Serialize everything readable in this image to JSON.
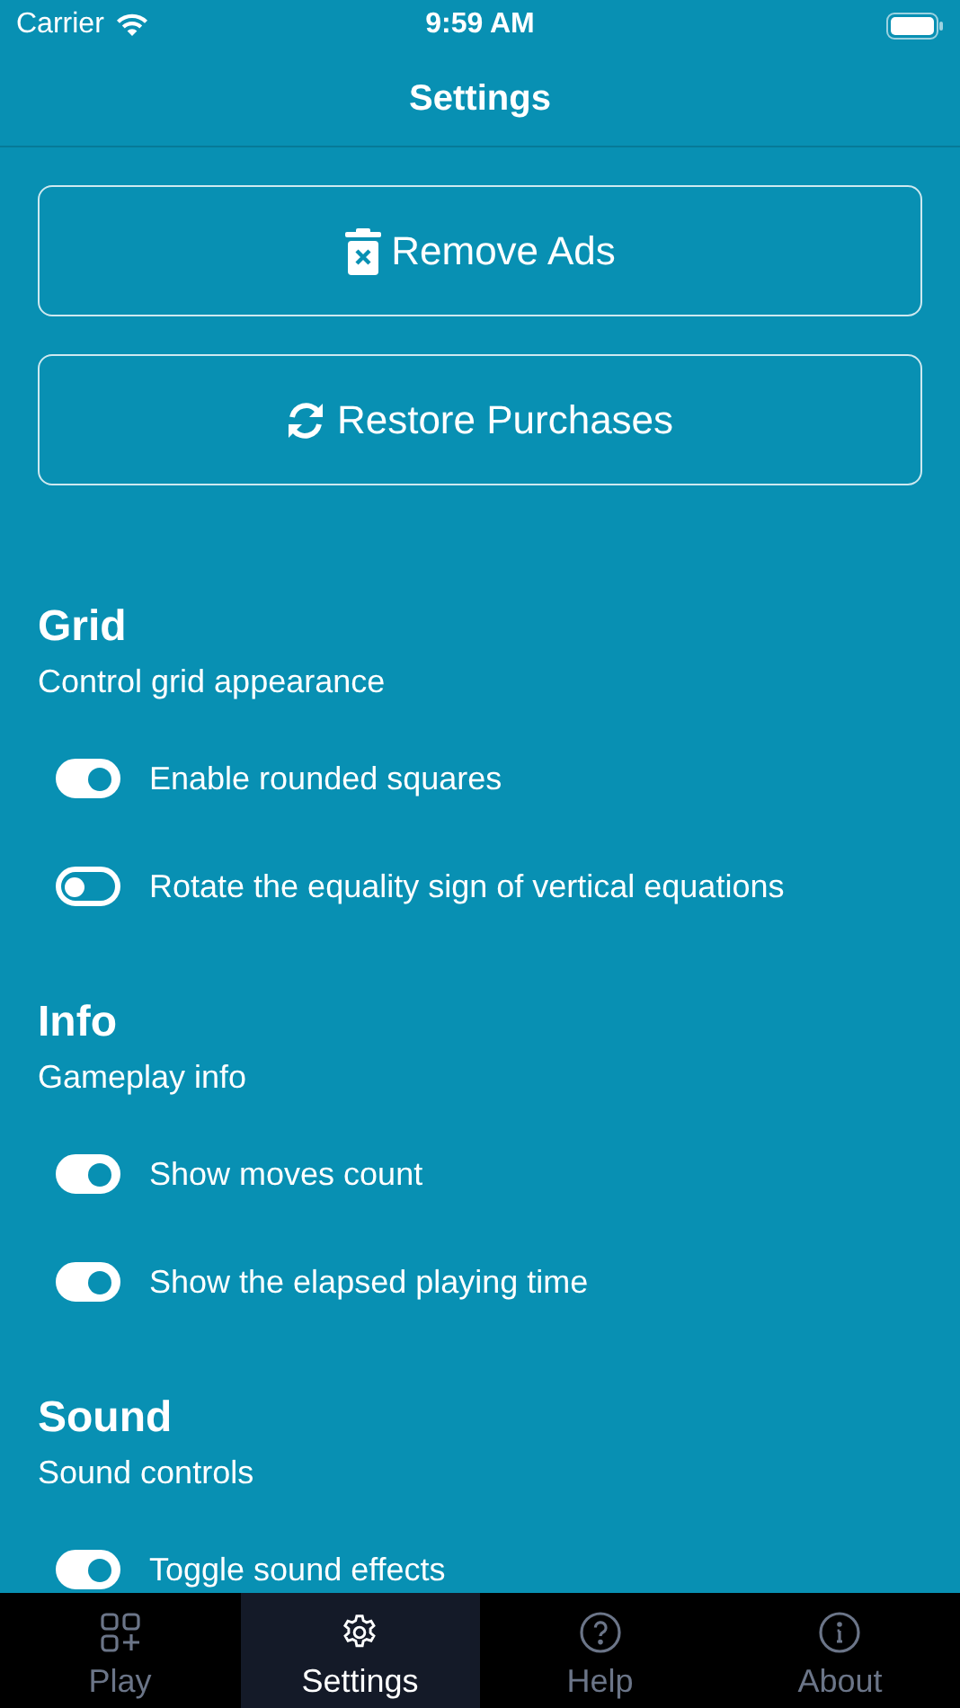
{
  "status_bar": {
    "carrier": "Carrier",
    "time": "9:59 AM"
  },
  "nav_bar": {
    "title": "Settings"
  },
  "buttons": [
    {
      "label": "Remove Ads",
      "kind": "trash"
    },
    {
      "label": "Restore Purchases",
      "kind": "refresh"
    }
  ],
  "sections": [
    {
      "title": "Grid",
      "subtitle": "Control grid appearance",
      "options": [
        {
          "label": "Enable rounded squares",
          "on": true
        },
        {
          "label": "Rotate the equality sign of vertical equations",
          "on": false
        }
      ]
    },
    {
      "title": "Info",
      "subtitle": "Gameplay info",
      "options": [
        {
          "label": "Show moves count",
          "on": true
        },
        {
          "label": "Show the elapsed playing time",
          "on": true
        }
      ]
    },
    {
      "title": "Sound",
      "subtitle": "Sound controls",
      "options": [
        {
          "label": "Toggle sound effects",
          "on": true
        }
      ]
    }
  ],
  "tabs": [
    {
      "label": "Play",
      "kind": "play",
      "selected": false
    },
    {
      "label": "Settings",
      "kind": "settings",
      "selected": true
    },
    {
      "label": "Help",
      "kind": "help",
      "selected": false
    },
    {
      "label": "About",
      "kind": "about",
      "selected": false
    }
  ]
}
